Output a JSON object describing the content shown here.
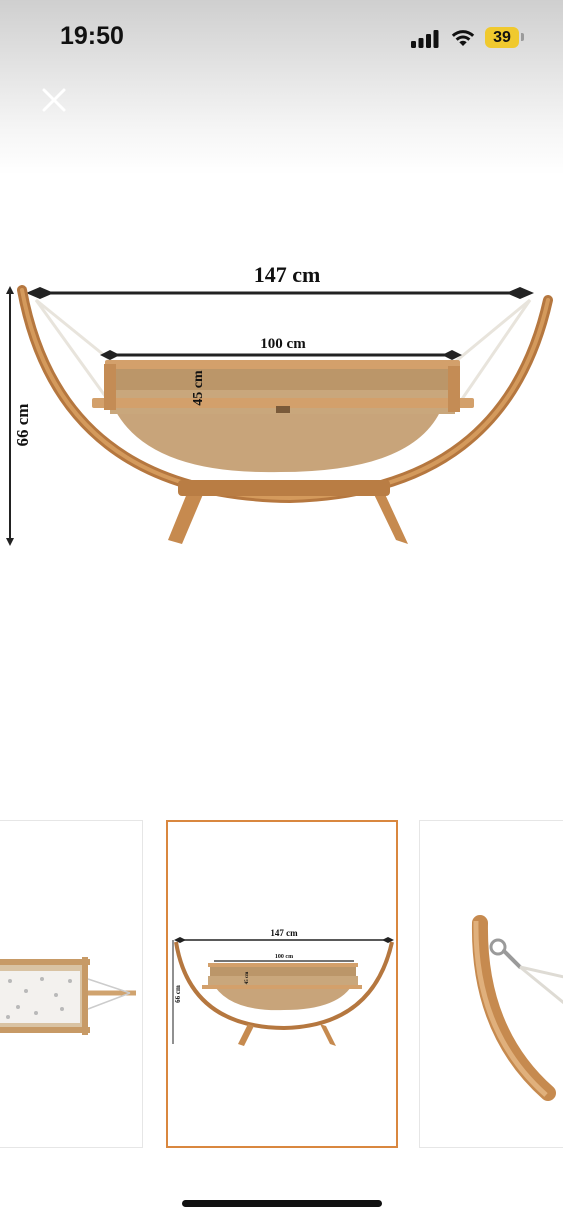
{
  "status_bar": {
    "time": "19:50",
    "battery_level": "39",
    "battery_color": "#f0c92e"
  },
  "close_button": {
    "icon": "close-icon"
  },
  "main_image": {
    "subject": "wooden arc hammock baby cradle with dimensions",
    "width_label": "147 cm",
    "inner_width_label": "100 cm",
    "depth_label": "45 cm",
    "height_label": "66 cm"
  },
  "thumbnails": {
    "selected_index": 1,
    "selected_border_color": "#d9873f",
    "items": [
      {
        "subject": "cradle top view with star-patterned mattress"
      },
      {
        "subject": "cradle with dimensions",
        "width_label": "147 cm",
        "inner_width_label": "100 cm",
        "depth_label": "45 cm",
        "height_label": "66 cm"
      },
      {
        "subject": "close-up of wooden arc and hook"
      }
    ]
  }
}
